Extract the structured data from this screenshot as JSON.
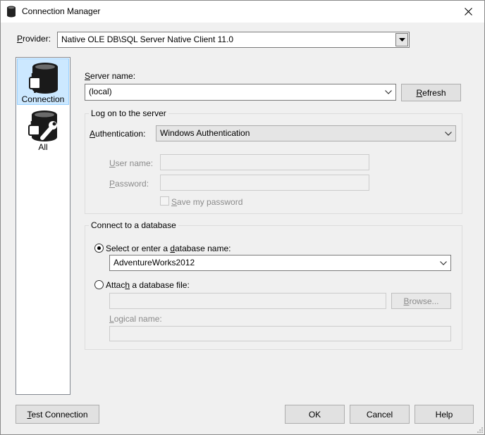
{
  "window": {
    "title": "Connection Manager",
    "title_icon": "database-icon",
    "close_icon": "close-icon"
  },
  "provider": {
    "label_mnemonic": "P",
    "label_rest": "rovider:",
    "value": "Native OLE DB\\SQL Server Native Client 11.0"
  },
  "sidebar": {
    "items": [
      {
        "label": "Connection",
        "icon": "database-plug-icon",
        "selected": true
      },
      {
        "label": "All",
        "icon": "database-wrench-icon",
        "selected": false
      }
    ]
  },
  "server": {
    "label_mnemonic": "S",
    "label_rest": "erver name:",
    "value": "(local)",
    "refresh_mnemonic": "R",
    "refresh_rest": "efresh"
  },
  "logon": {
    "group_title": "Log on to the server",
    "auth_label_mnemonic": "A",
    "auth_label_rest": "uthentication:",
    "auth_value": "Windows Authentication",
    "username_mnemonic": "U",
    "username_rest": "ser name:",
    "username_value": "",
    "password_mnemonic": "P",
    "password_rest": "assword:",
    "password_value": "",
    "save_mnemonic": "S",
    "save_rest": "ave my password",
    "save_checked": false
  },
  "database": {
    "group_title": "Connect to a database",
    "select_pre": "Select or enter a ",
    "select_mnemonic": "d",
    "select_post": "atabase name:",
    "select_checked": true,
    "db_value": "AdventureWorks2012",
    "attach_pre": "Attac",
    "attach_mnemonic": "h",
    "attach_post": " a database file:",
    "attach_checked": false,
    "file_value": "",
    "browse_mnemonic": "B",
    "browse_rest": "rowse...",
    "logical_mnemonic": "L",
    "logical_rest": "ogical name:",
    "logical_value": ""
  },
  "footer": {
    "test_mnemonic": "T",
    "test_rest": "est Connection",
    "ok": "OK",
    "cancel": "Cancel",
    "help": "Help"
  }
}
